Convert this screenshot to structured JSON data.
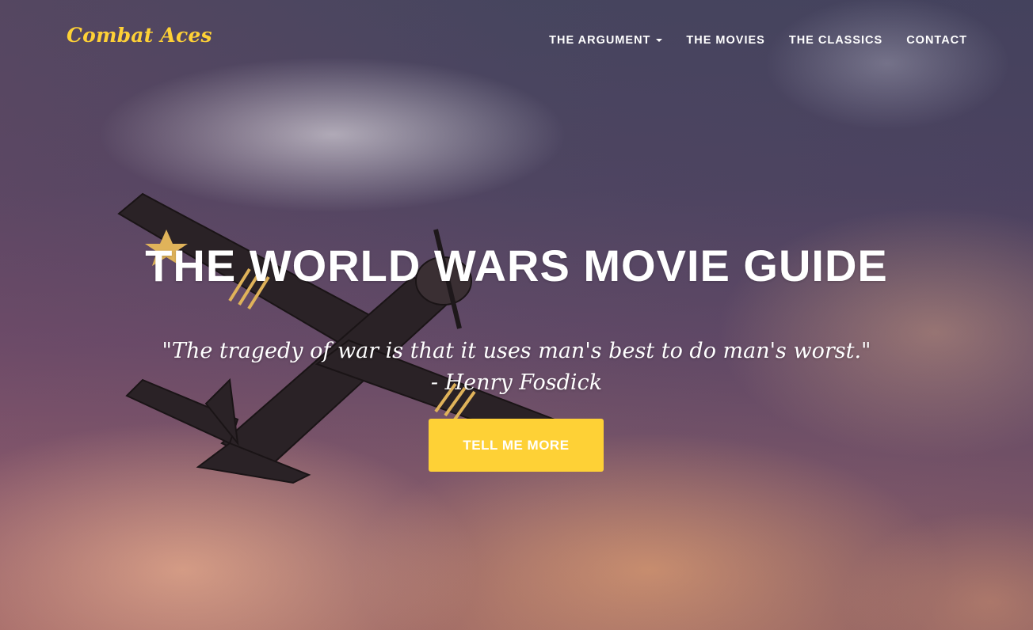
{
  "brand": {
    "name": "Combat Aces",
    "color": "#fed136"
  },
  "nav": {
    "items": [
      {
        "label": "THE ARGUMENT",
        "has_dropdown": true,
        "icon": "caret-down-icon"
      },
      {
        "label": "THE MOVIES"
      },
      {
        "label": "THE CLASSICS"
      },
      {
        "label": "CONTACT"
      }
    ]
  },
  "hero": {
    "title": "THE WORLD WARS MOVIE GUIDE",
    "quote": "\"The tragedy of war is that it uses man's best to do man's worst.\"",
    "attribution": "- Henry Fosdick",
    "cta_label": "TELL ME MORE",
    "background_image": "propeller fighter plane flying through clouds at sunset",
    "accent": "#fed136"
  }
}
